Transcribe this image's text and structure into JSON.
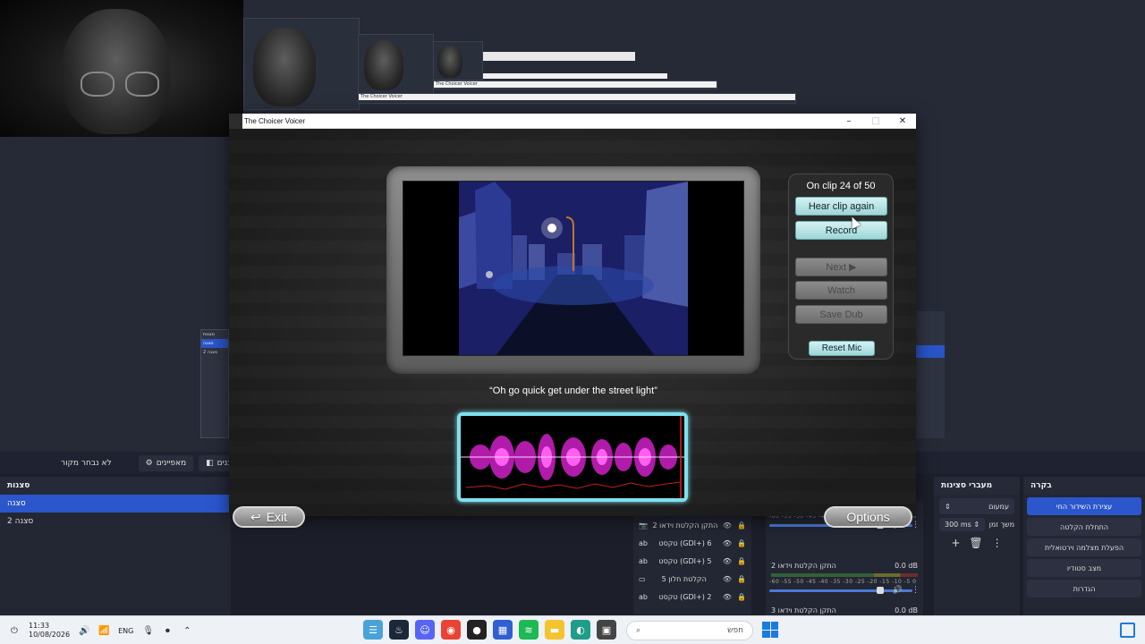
{
  "background": {
    "recursive_window_titles": [
      "The Choicer Voicer",
      "The Choicer Voicer"
    ],
    "obs_scene_thumb": {
      "header": "סצנות",
      "items": [
        "סצנה",
        "סצנה 2"
      ]
    }
  },
  "obs": {
    "toolbar": {
      "no_source": "לא נבחר מקור",
      "properties": "מאפיינים",
      "filters": "מסננים"
    },
    "scenes": {
      "title": "סצנות",
      "items": [
        "סצנה",
        "סצנה 2"
      ]
    },
    "sources": {
      "items": [
        {
          "label": "התקן הקלטת וידאו 2",
          "icon": "camera-icon"
        },
        {
          "label": "טקסט (GDI+) 6",
          "icon": "text-icon"
        },
        {
          "label": "טקסט (GDI+) 5",
          "icon": "text-icon"
        },
        {
          "label": "הקלטת חלון 5",
          "icon": "window-icon"
        },
        {
          "label": "טקסט (GDI+) 2",
          "icon": "text-icon"
        }
      ]
    },
    "mixer": {
      "scale": "-60 -55 -50 -45 -40 -35 -30 -25 -20 -15 -10 -5 0",
      "channels": [
        {
          "name": "התקן הקלטת וידאו 2",
          "db": "0.0 dB"
        },
        {
          "name": "התקן הקלטת וידאו 3",
          "db": "0.0 dB"
        }
      ]
    },
    "transitions": {
      "title": "מעברי סצינות",
      "fade": "עמעום",
      "duration_label": "משך זמן",
      "duration": "300 ms"
    },
    "controls": {
      "title": "בקרה",
      "buttons": [
        "עצירת השידור החי",
        "התחלת הקלטה",
        "הפעלת מצלמה וירטואלית",
        "מצב סטודיו",
        "הגדרות"
      ]
    }
  },
  "cv": {
    "title": "The Choicer Voicer",
    "clip_counter": "On clip 24 of 50",
    "buttons": {
      "hear_again": "Hear clip again",
      "record": "Record",
      "next": "Next ▶",
      "watch": "Watch",
      "save_dub": "Save Dub",
      "reset_mic": "Reset Mic"
    },
    "quote": "“Oh go quick get under the street light”",
    "exit": "Exit",
    "options": "Options"
  },
  "taskbar": {
    "time": "11:33",
    "date": "10/08/2026",
    "lang": "ENG",
    "search_placeholder": "חפש"
  }
}
